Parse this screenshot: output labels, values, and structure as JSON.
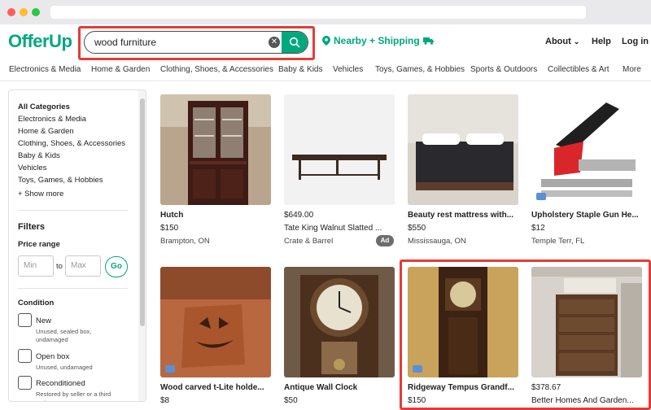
{
  "search": {
    "value": "wood furniture",
    "placeholder": ""
  },
  "header": {
    "logo": "OfferUp",
    "nearby": "Nearby + Shipping",
    "about": "About",
    "help": "Help",
    "login": "Log in"
  },
  "categories": [
    "Electronics & Media",
    "Home & Garden",
    "Clothing, Shoes, & Accessories",
    "Baby & Kids",
    "Vehicles",
    "Toys, Games, & Hobbies",
    "Sports & Outdoors",
    "Collectibles & Art",
    "More"
  ],
  "sidebar": {
    "items": [
      "All Categories",
      "Electronics & Media",
      "Home & Garden",
      "Clothing, Shoes, & Accessories",
      "Baby & Kids",
      "Vehicles",
      "Toys, Games, & Hobbies"
    ],
    "show_more": "+ Show more",
    "filters": "Filters",
    "price_range": "Price range",
    "min": "Min",
    "to": "to",
    "max": "Max",
    "go": "Go",
    "condition": "Condition",
    "conditions": [
      {
        "label": "New",
        "desc": "Unused, sealed box, undamaged"
      },
      {
        "label": "Open box",
        "desc": "Unused, undamaged"
      },
      {
        "label": "Reconditioned",
        "desc": "Restored by seller or a third party"
      }
    ]
  },
  "listings": [
    {
      "title": "Hutch",
      "price": "$150",
      "location": "Brampton, ON"
    },
    {
      "title": "Tate King Walnut Slatted ...",
      "price": "$649.00",
      "location": "Crate & Barrel",
      "ad": "Ad"
    },
    {
      "title": "Beauty rest mattress with...",
      "price": "$550",
      "location": "Mississauga, ON"
    },
    {
      "title": "Upholstery Staple Gun He...",
      "price": "$12",
      "location": "Temple Terr, FL"
    },
    {
      "title": "Wood carved t-Lite holde...",
      "price": "$8",
      "location": ""
    },
    {
      "title": "Antique Wall Clock",
      "price": "$50",
      "location": ""
    },
    {
      "title": "Ridgeway Tempus Grandf...",
      "price": "$150",
      "location": ""
    },
    {
      "title": "Better Homes And Garden...",
      "price": "$378.67",
      "location": ""
    }
  ]
}
